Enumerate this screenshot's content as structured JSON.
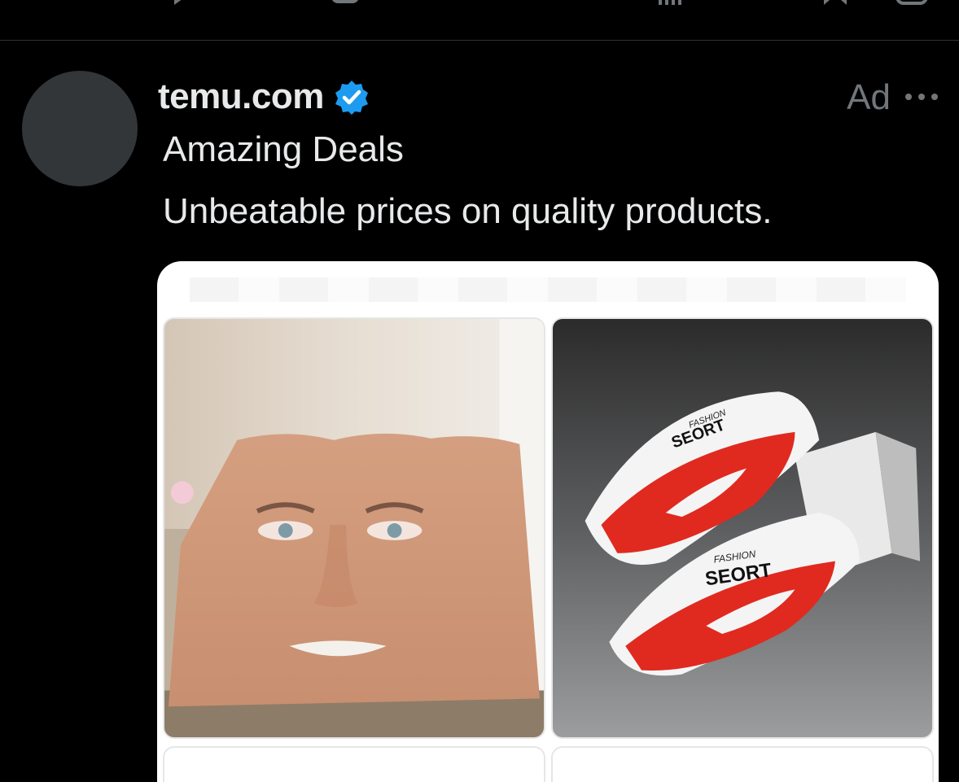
{
  "post": {
    "author": "temu.com",
    "verified": true,
    "ad_label": "Ad",
    "headline": "Amazing Deals",
    "body": "Unbeatable prices on quality products."
  },
  "products": [
    {
      "icon": "blanket-product-image",
      "brand_text": ""
    },
    {
      "icon": "slide-sandals-product-image",
      "brand_text": "FASHION SEORT"
    }
  ],
  "colors": {
    "background": "#000000",
    "text": "#e7e9ea",
    "muted": "#71767b",
    "verified_blue": "#1d9bf0",
    "avatar": "#333639",
    "sandal_red": "#e0291f"
  }
}
